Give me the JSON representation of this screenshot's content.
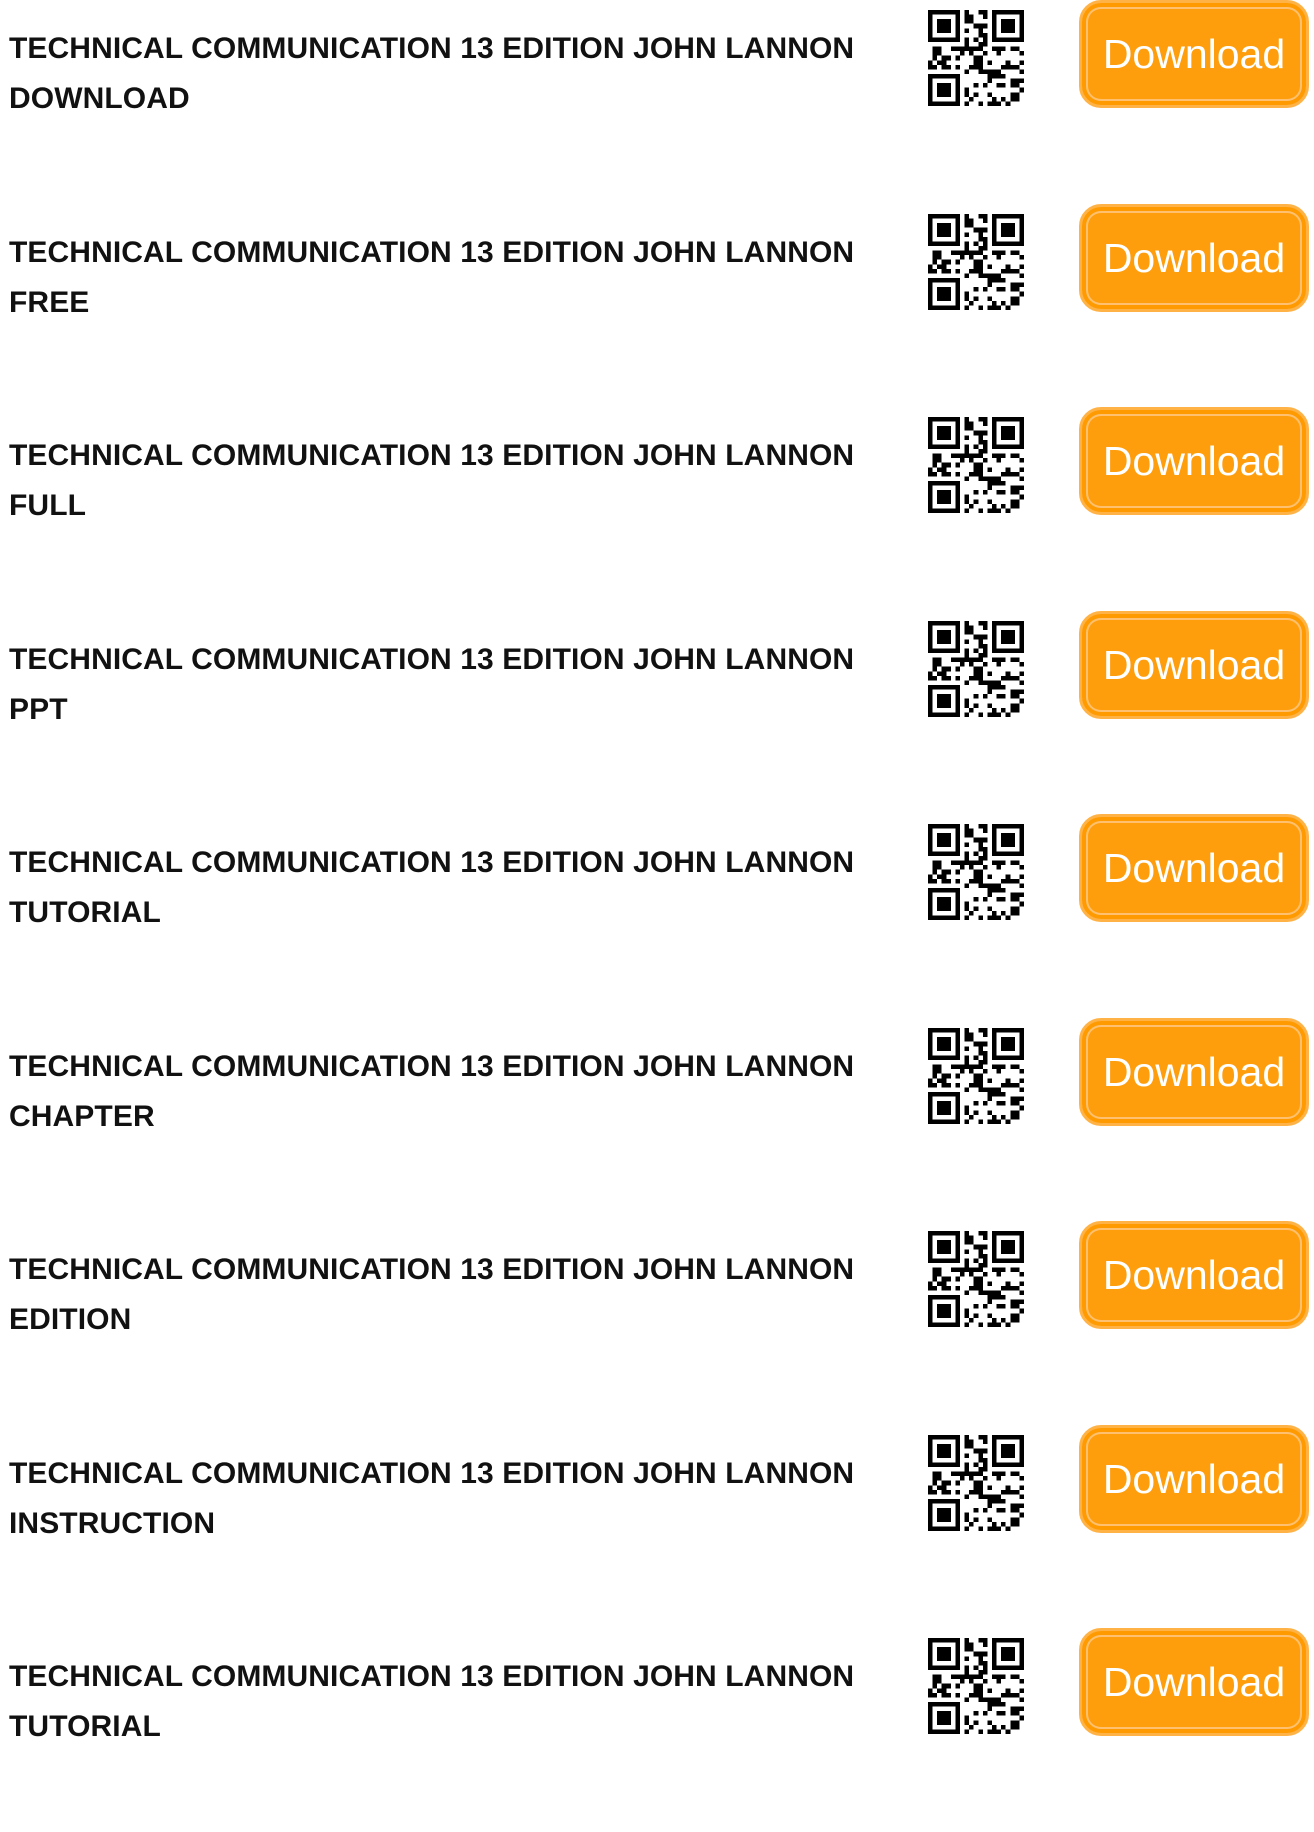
{
  "rows": [
    {
      "title_line1": "TECHNICAL COMMUNICATION 13 EDITION JOHN LANNON",
      "title_line2": "DOWNLOAD",
      "button_label": "Download"
    },
    {
      "title_line1": "TECHNICAL COMMUNICATION 13 EDITION JOHN LANNON",
      "title_line2": "FREE",
      "button_label": "Download"
    },
    {
      "title_line1": "TECHNICAL COMMUNICATION 13 EDITION JOHN LANNON",
      "title_line2": "FULL",
      "button_label": "Download"
    },
    {
      "title_line1": "TECHNICAL COMMUNICATION 13 EDITION JOHN LANNON",
      "title_line2": "PPT",
      "button_label": "Download"
    },
    {
      "title_line1": "TECHNICAL COMMUNICATION 13 EDITION JOHN LANNON",
      "title_line2": "TUTORIAL",
      "button_label": "Download"
    },
    {
      "title_line1": "TECHNICAL COMMUNICATION 13 EDITION JOHN LANNON",
      "title_line2": "CHAPTER",
      "button_label": "Download"
    },
    {
      "title_line1": "TECHNICAL COMMUNICATION 13 EDITION JOHN LANNON",
      "title_line2": "EDITION",
      "button_label": "Download"
    },
    {
      "title_line1": "TECHNICAL COMMUNICATION 13 EDITION JOHN LANNON",
      "title_line2": "INSTRUCTION",
      "button_label": "Download"
    },
    {
      "title_line1": "TECHNICAL COMMUNICATION 13 EDITION JOHN LANNON",
      "title_line2": "TUTORIAL",
      "button_label": "Download"
    }
  ],
  "colors": {
    "button_fill": "#ff9e0d",
    "button_text": "#ffffff",
    "title_text": "#111111"
  },
  "icons": {
    "qr": "qr-code-icon"
  }
}
